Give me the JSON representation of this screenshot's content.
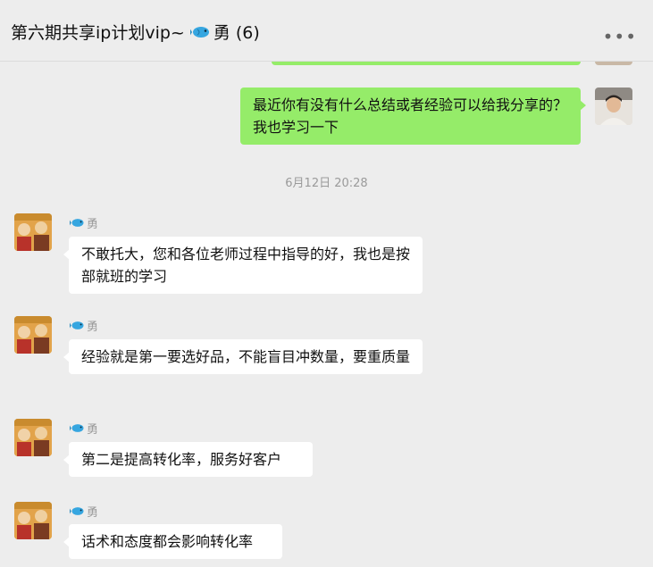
{
  "header": {
    "title_prefix": "第六期共享ip计划vip~",
    "title_suffix": "勇 (6)",
    "more_icon": "•••"
  },
  "messages": [
    {
      "from": "me",
      "text": "最近你有没有什么总结或者经验可以给我分享的？我也学习一下"
    }
  ],
  "timestamp": "6月12日 20:28",
  "replies": [
    {
      "sender": "勇",
      "text": "不敢托大，您和各位老师过程中指导的好，我也是按部就班的学习"
    },
    {
      "sender": "勇",
      "text": "经验就是第一要选好品，不能盲目冲数量，要重质量"
    },
    {
      "sender": "勇",
      "text": "第二是提高转化率，服务好客户"
    },
    {
      "sender": "勇",
      "text": "话术和态度都会影响转化率"
    }
  ],
  "colors": {
    "my_bubble": "#95ec69",
    "other_bubble": "#ffffff",
    "background": "#ededed"
  }
}
